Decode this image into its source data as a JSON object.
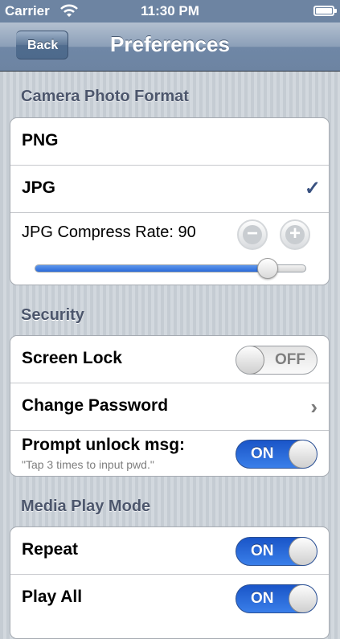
{
  "status_bar": {
    "carrier": "Carrier",
    "time": "11:30 PM"
  },
  "nav": {
    "back_label": "Back",
    "title": "Preferences"
  },
  "camera": {
    "header": "Camera Photo Format",
    "options": [
      {
        "label": "PNG",
        "selected": false
      },
      {
        "label": "JPG",
        "selected": true
      }
    ],
    "checkmark": "✓",
    "compress_label": "JPG Compress Rate: 90",
    "compress_value": 90,
    "minus_glyph": "−",
    "plus_glyph": "+"
  },
  "security": {
    "header": "Security",
    "screen_lock": {
      "label": "Screen Lock",
      "state": "OFF"
    },
    "change_password": {
      "label": "Change Password",
      "chevron": "›"
    },
    "prompt_unlock": {
      "label": "Prompt unlock msg:",
      "sublabel": "\"Tap 3 times to input pwd.\"",
      "state": "ON"
    }
  },
  "media": {
    "header": "Media Play Mode",
    "repeat": {
      "label": "Repeat",
      "state": "ON"
    },
    "play_all": {
      "label": "Play All",
      "state": "ON"
    }
  },
  "colors": {
    "nav": "#6d84a2",
    "toggle_on": "#2f6fdf",
    "checkmark": "#395180",
    "header_text": "#4c566c"
  }
}
